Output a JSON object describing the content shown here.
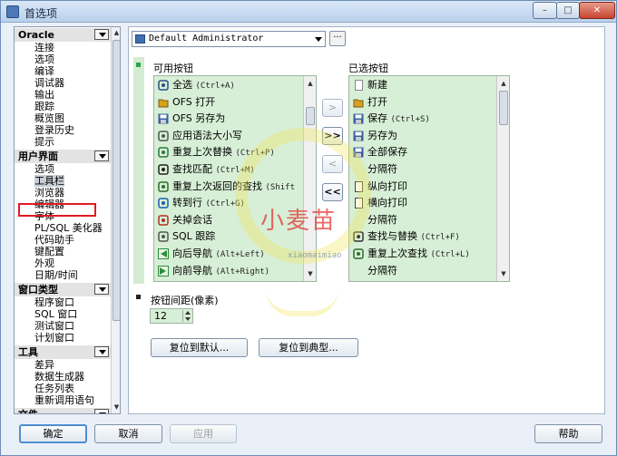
{
  "window": {
    "title": "首选项",
    "min": "–",
    "max": "□",
    "close": "✕"
  },
  "sidebar": {
    "categories": [
      {
        "label": "Oracle",
        "items": [
          "连接",
          "选项",
          "编译",
          "调试器",
          "输出",
          "跟踪",
          "概览图",
          "登录历史",
          "提示"
        ]
      },
      {
        "label": "用户界面",
        "items": [
          "选项",
          "工具栏",
          "浏览器",
          "编辑器",
          "字体",
          "PL/SQL 美化器",
          "代码助手",
          "键配置",
          "外观",
          "日期/时间"
        ]
      },
      {
        "label": "窗口类型",
        "items": [
          "程序窗口",
          "SQL 窗口",
          "测试窗口",
          "计划窗口"
        ]
      },
      {
        "label": "工具",
        "items": [
          "差异",
          "数据生成器",
          "任务列表",
          "重新调用语句"
        ]
      },
      {
        "label": "文件",
        "items": []
      }
    ],
    "selected": "工具栏"
  },
  "profile": {
    "value": "Default Administrator",
    "more": "···"
  },
  "available": {
    "label": "可用按钮",
    "items": [
      {
        "icon": "select-all-icon",
        "text": "全选",
        "shortcut": "(Ctrl+A)"
      },
      {
        "icon": "ofs-open-icon",
        "text": "OFS 打开",
        "shortcut": ""
      },
      {
        "icon": "ofs-save-as-icon",
        "text": "OFS 另存为",
        "shortcut": ""
      },
      {
        "icon": "case-icon",
        "text": "应用语法大小写",
        "shortcut": ""
      },
      {
        "icon": "redo-replace-icon",
        "text": "重复上次替换",
        "shortcut": "(Ctrl+P)"
      },
      {
        "icon": "match-icon",
        "text": "查找匹配",
        "shortcut": "(Ctrl+M)"
      },
      {
        "icon": "redo-find-icon",
        "text": "重复上次返回的查找",
        "shortcut": "(Shift"
      },
      {
        "icon": "goto-line-icon",
        "text": "转到行",
        "shortcut": "(Ctrl+G)"
      },
      {
        "icon": "close-session-icon",
        "text": "关掉会话",
        "shortcut": ""
      },
      {
        "icon": "sql-trace-icon",
        "text": "SQL 跟踪",
        "shortcut": ""
      },
      {
        "icon": "nav-back-icon",
        "text": "向后导航",
        "shortcut": "(Alt+Left)"
      },
      {
        "icon": "nav-forward-icon",
        "text": "向前导航",
        "shortcut": "(Alt+Right)"
      }
    ]
  },
  "selected_buttons": {
    "label": "已选按钮",
    "items": [
      {
        "icon": "new-icon",
        "text": "新建",
        "shortcut": ""
      },
      {
        "icon": "open-icon",
        "text": "打开",
        "shortcut": ""
      },
      {
        "icon": "save-icon",
        "text": "保存",
        "shortcut": "(Ctrl+S)"
      },
      {
        "icon": "save-as-icon",
        "text": "另存为",
        "shortcut": ""
      },
      {
        "icon": "save-all-icon",
        "text": "全部保存",
        "shortcut": ""
      },
      {
        "icon": "",
        "text": "分隔符",
        "shortcut": ""
      },
      {
        "icon": "print-portrait-icon",
        "text": "纵向打印",
        "shortcut": ""
      },
      {
        "icon": "print-landscape-icon",
        "text": "横向打印",
        "shortcut": ""
      },
      {
        "icon": "",
        "text": "分隔符",
        "shortcut": ""
      },
      {
        "icon": "find-replace-icon",
        "text": "查找与替换",
        "shortcut": "(Ctrl+F)"
      },
      {
        "icon": "redo-find-icon",
        "text": "重复上次查找",
        "shortcut": "(Ctrl+L)"
      },
      {
        "icon": "",
        "text": "分隔符",
        "shortcut": ""
      }
    ]
  },
  "move_buttons": {
    "add": ">",
    "add_all": ">>",
    "remove": "<",
    "remove_all": "<<"
  },
  "spacing": {
    "label": "按钮间距(像素)",
    "value": "12"
  },
  "reset_default": "复位到默认...",
  "reset_typical": "复位到典型...",
  "footer": {
    "ok": "确定",
    "cancel": "取消",
    "apply": "应用",
    "help": "帮助"
  },
  "watermark": {
    "text": "小麦苗",
    "url": "xiaomaimiao"
  }
}
